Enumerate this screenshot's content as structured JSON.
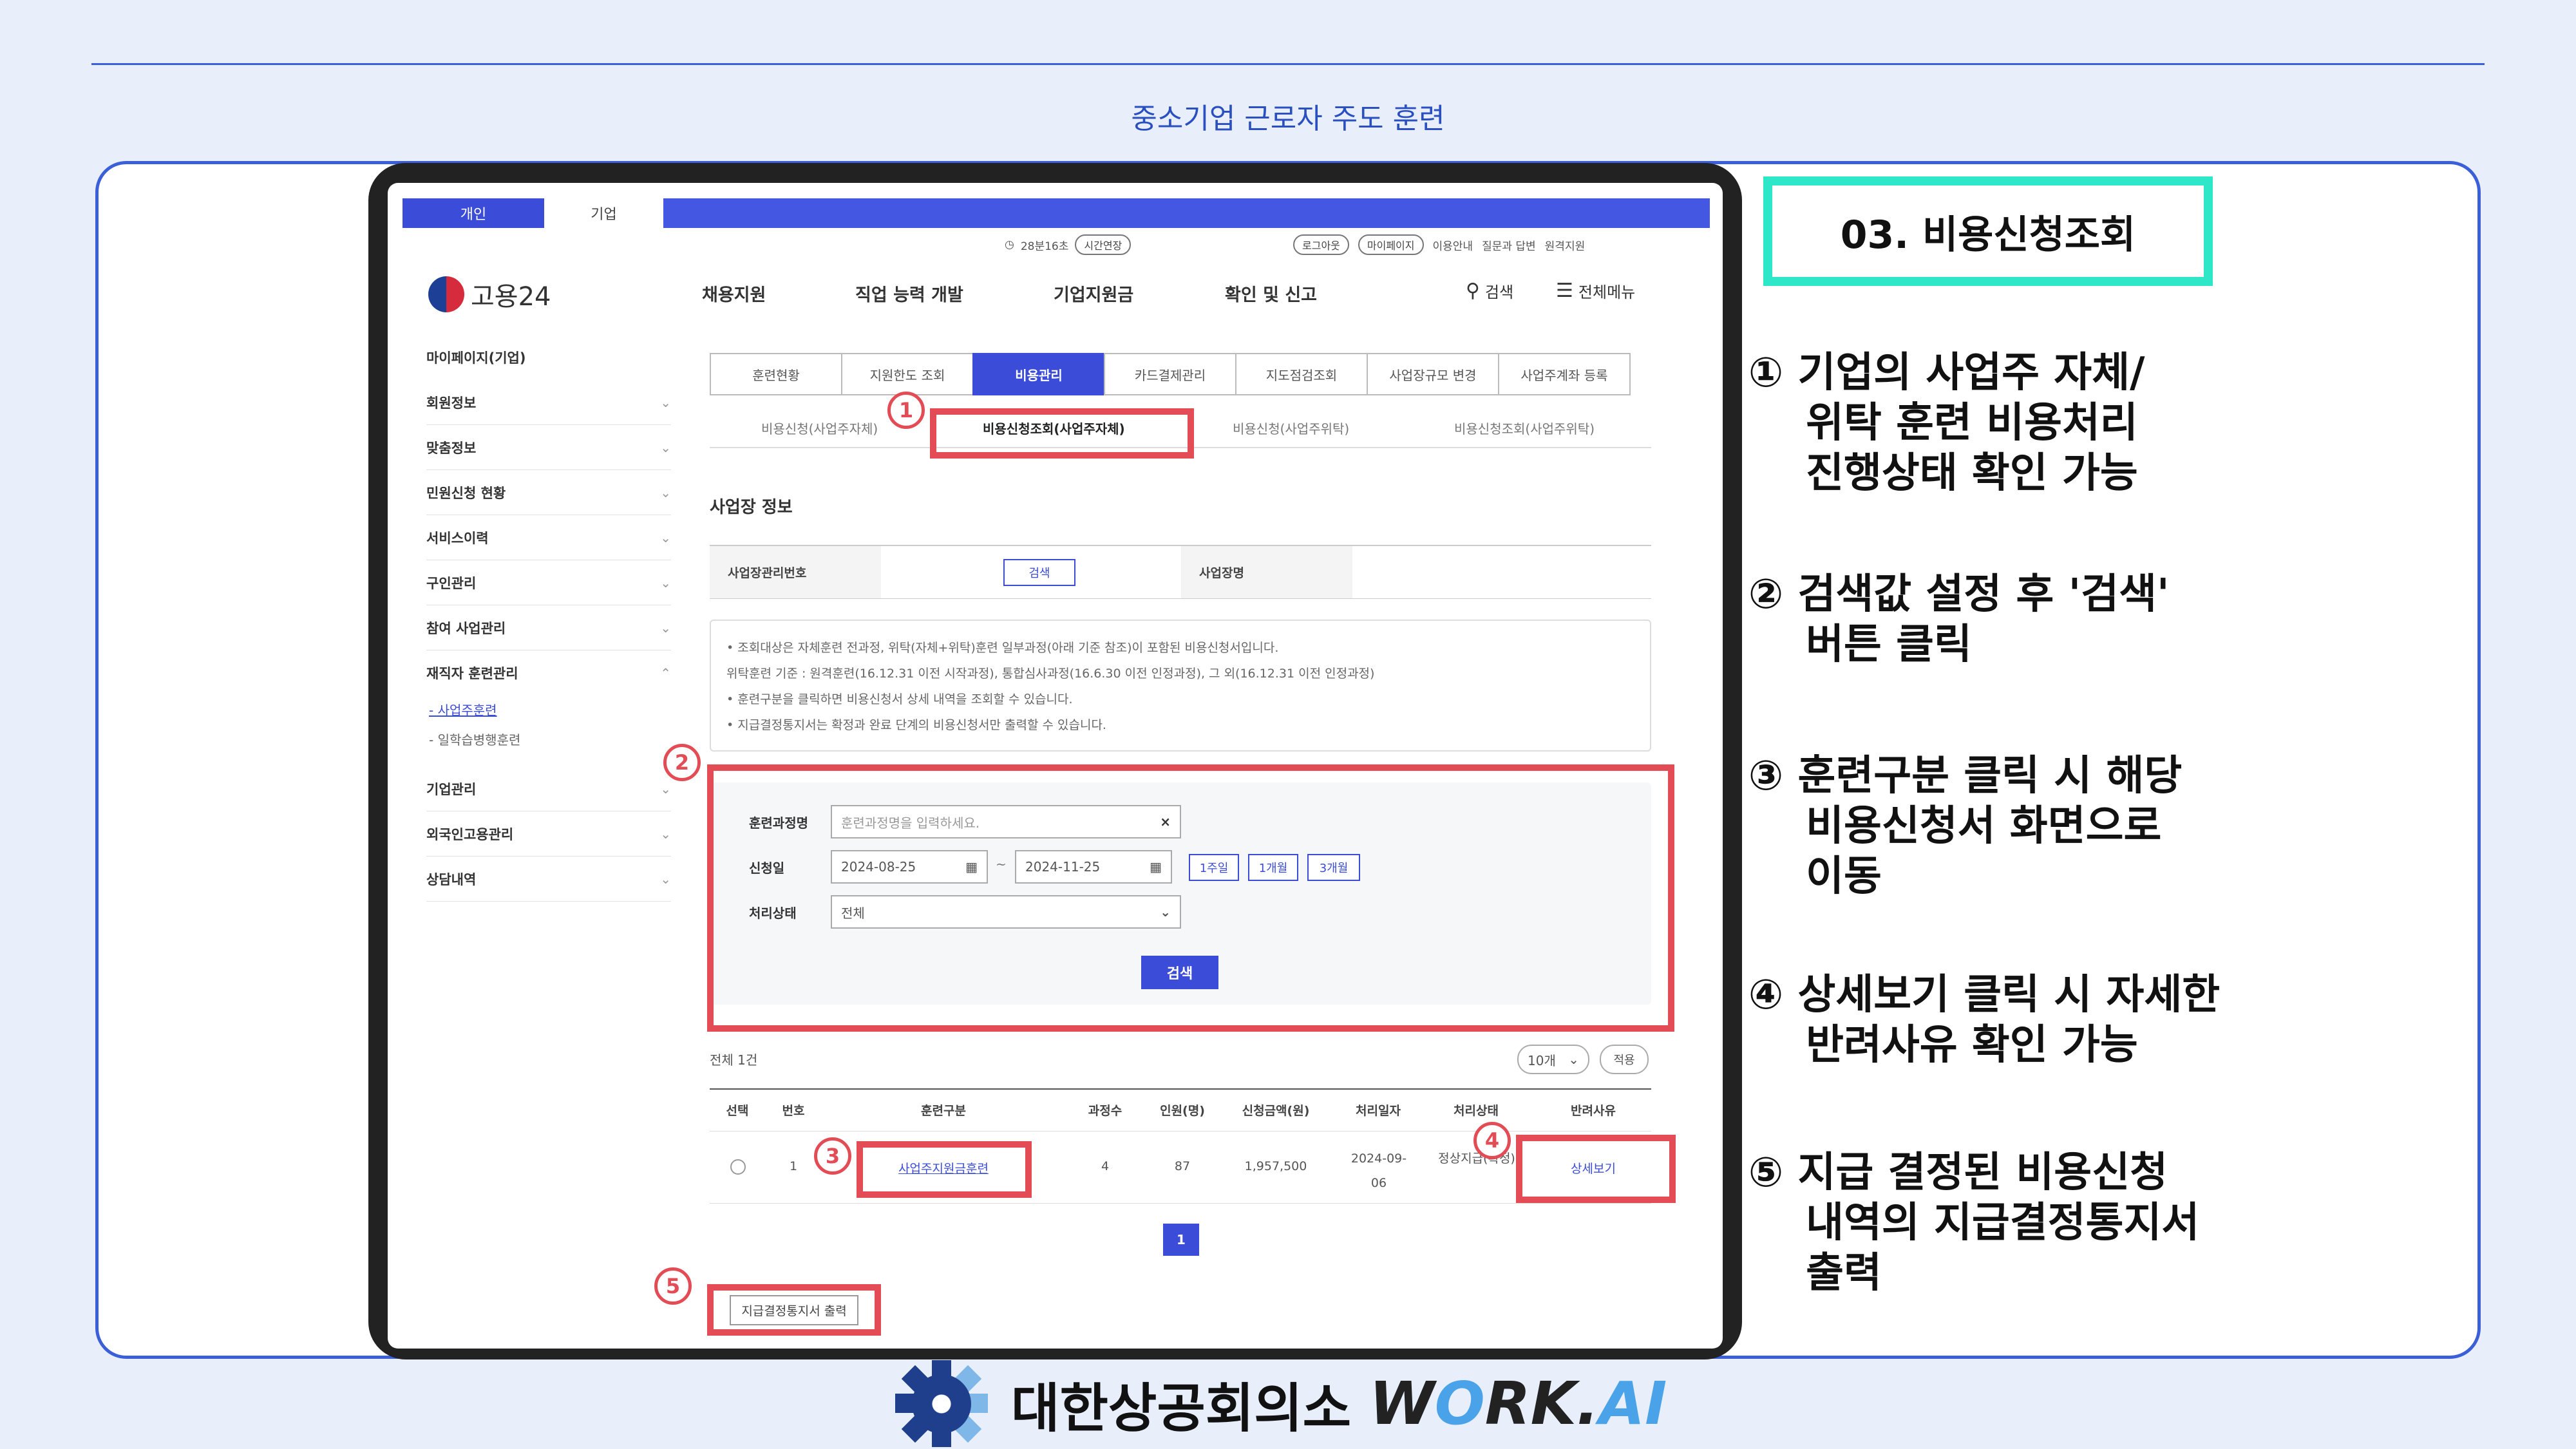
{
  "slide": {
    "subtitle": "중소기업 근로자 주도 훈련",
    "section_title": "03. 비용신청조회",
    "points": [
      {
        "text": "① 기업의 사업주 자체/\n    위탁 훈련 비용처리\n    진행상태 확인 가능"
      },
      {
        "text": "② 검색값 설정 후 '검색'\n    버튼 클릭"
      },
      {
        "text": "③ 훈련구분 클릭 시 해당\n    비용신청서 화면으로\n    이동"
      },
      {
        "text": "④ 상세보기 클릭 시 자세한\n    반려사유 확인 가능"
      },
      {
        "text": "⑤ 지급 결정된 비용신청\n    내역의 지급결정통지서\n    출력"
      }
    ],
    "footer": {
      "org": "대한상공회의소",
      "brand_a": "W",
      "brand_o": "O",
      "brand_b": "RK.",
      "brand_ai": "AI"
    }
  },
  "site": {
    "user_tabs": [
      "개인",
      "기업"
    ],
    "session": "28분16초",
    "extend": "시간연장",
    "logout": "로그아웃",
    "mypage": "마이페이지",
    "util_links": [
      "이용안내",
      "질문과 답변",
      "원격지원"
    ],
    "logo_text": "고용24",
    "gnb": [
      "채용지원",
      "직업 능력 개발",
      "기업지원금",
      "확인 및 신고"
    ],
    "search": "검색",
    "allmenu": "전체메뉴"
  },
  "sidebar": {
    "heading": "마이페이지(기업)",
    "items": [
      "회원정보",
      "맞춤정보",
      "민원신청 현황",
      "서비스이력",
      "구인관리",
      "참여 사업관리",
      "재직자 훈련관리",
      "기업관리",
      "외국인고용관리",
      "상담내역"
    ],
    "subitems": [
      "- 사업주훈련",
      "- 일학습병행훈련"
    ]
  },
  "tabs": [
    "훈련현황",
    "지원한도 조회",
    "비용관리",
    "카드결제관리",
    "지도점검조회",
    "사업장규모 변경",
    "사업주계좌 등록"
  ],
  "subtabs": [
    "비용신청(사업주자체)",
    "비용신청조회(사업주자체)",
    "비용신청(사업주위탁)",
    "비용신청조회(사업주위탁)"
  ],
  "workplace": {
    "title": "사업장 정보",
    "mgmt_no_label": "사업장관리번호",
    "search_btn": "검색",
    "name_label": "사업장명"
  },
  "notices": [
    "• 조회대상은 자체훈련 전과정, 위탁(자체+위탁)훈련 일부과정(아래 기준 참조)이 포함된 비용신청서입니다.",
    "   위탁훈련 기준 : 원격훈련(16.12.31 이전 시작과정), 통합심사과정(16.6.30 이전 인정과정), 그 외(16.12.31 이전 인정과정)",
    "• 훈련구분을 클릭하면 비용신청서 상세 내역을 조회할 수 있습니다.",
    "• 지급결정통지서는 확정과 완료 단계의 비용신청서만 출력할 수 있습니다."
  ],
  "form": {
    "course_label": "훈련과정명",
    "course_placeholder": "훈련과정명을 입력하세요.",
    "clear": "×",
    "date_label": "신청일",
    "date_from": "2024-08-25",
    "date_sep": "~",
    "date_to": "2024-11-25",
    "period_buttons": [
      "1주일",
      "1개월",
      "3개월"
    ],
    "status_label": "처리상태",
    "status_value": "전체",
    "search_btn": "검색"
  },
  "results": {
    "total": "전체 1건",
    "page_size": "10개",
    "apply": "적용",
    "columns": [
      "선택",
      "번호",
      "훈련구분",
      "과정수",
      "인원(명)",
      "신청금액(원)",
      "처리일자",
      "처리상태",
      "반려사유"
    ],
    "rows": [
      {
        "no": "1",
        "type": "사업주지원금훈련",
        "courses": "4",
        "people": "87",
        "amount": "1,957,500",
        "date": "2024-09-06",
        "status": "정상지급(확정)",
        "detail": "상세보기"
      }
    ],
    "page": "1",
    "print_btn": "지급결정통지서 출력"
  },
  "markers": [
    "1",
    "2",
    "3",
    "4",
    "5"
  ],
  "colors": {
    "accent": "#3b4dd8",
    "highlight": "#e34b55",
    "teal": "#2ee6c8",
    "navy": "#1f3f8c"
  }
}
